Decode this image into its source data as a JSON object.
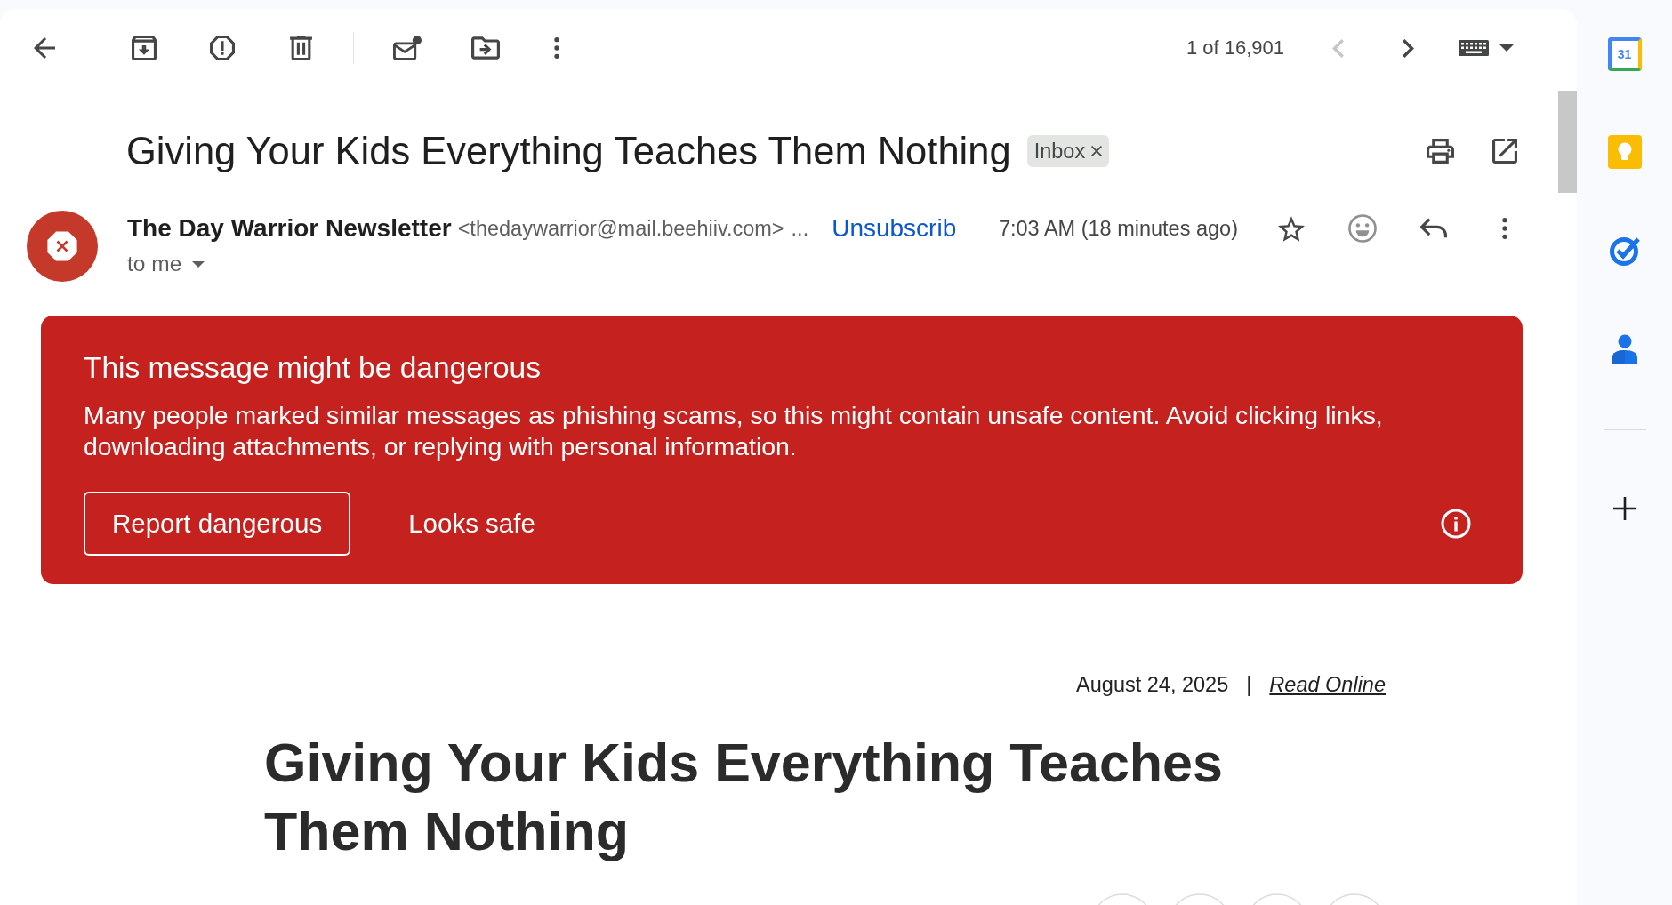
{
  "toolbar": {
    "pager": {
      "text": "1 of 16,901",
      "previous_disabled": true,
      "next_disabled": false
    }
  },
  "subject": {
    "title": "Giving Your Kids Everything Teaches Them Nothing",
    "labels": [
      {
        "text": "Inbox"
      }
    ]
  },
  "message": {
    "sender_name": "The Day Warrior Newsletter",
    "sender_address": "<thedaywarrior@mail.beehiiv.com>",
    "address_more": "...",
    "unsubscribe": "Unsubscrib",
    "time": "7:03 AM (18 minutes ago)",
    "starred": false,
    "recipient": "to me"
  },
  "warning": {
    "title": "This message might be dangerous",
    "body": "Many people marked similar messages as phishing scams, so this might contain unsafe content. Avoid clicking links, downloading attachments, or replying with personal information.",
    "buttons": [
      {
        "label": "Report dangerous",
        "kind": "outlined"
      },
      {
        "label": "Looks safe",
        "kind": "text"
      }
    ]
  },
  "newsletter": {
    "date": "August 24, 2025",
    "separator": "|",
    "read_online": "Read Online",
    "headline": "Giving Your Kids Everything Teaches Them Nothing"
  },
  "sidebar": {
    "apps": [
      {
        "kind": "calendar",
        "day": "31"
      },
      {
        "kind": "keep"
      },
      {
        "kind": "tasks"
      },
      {
        "kind": "contacts"
      }
    ]
  }
}
